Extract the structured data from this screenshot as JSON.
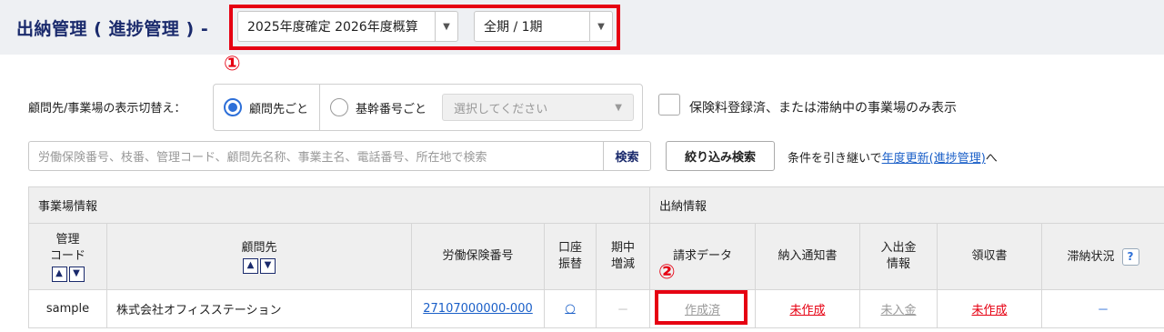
{
  "header": {
    "title": "出納管理 ( 進捗管理 ) -",
    "year_select": "2025年度確定 2026年度概算",
    "period_select": "全期 / 1期"
  },
  "annotations": {
    "one": "①",
    "two": "②"
  },
  "filters": {
    "toggle_label": "顧問先/事業場の表示切替え：",
    "radio_client": "顧問先ごと",
    "radio_base": "基幹番号ごと",
    "base_select_placeholder": "選択してください",
    "checkbox_label": "保険料登録済、または滞納中の事業場のみ表示"
  },
  "search": {
    "placeholder": "労働保険番号、枝番、管理コード、顧問先名称、事業主名、電話番号、所在地で検索",
    "search_button": "検索",
    "filter_button": "絞り込み検索",
    "carry_text": "条件を引き継いで",
    "carry_link": "年度更新(進捗管理)",
    "carry_suffix": "へ"
  },
  "table": {
    "group_site": "事業場情報",
    "group_payment": "出納情報",
    "col_code_line1": "管理",
    "col_code_line2": "コード",
    "col_client": "顧問先",
    "col_insurance_no": "労働保険番号",
    "col_account_line1": "口座",
    "col_account_line2": "振替",
    "col_change_line1": "期中",
    "col_change_line2": "増減",
    "col_billing": "請求データ",
    "col_notice": "納入通知書",
    "col_inout_line1": "入出金",
    "col_inout_line2": "情報",
    "col_receipt": "領収書",
    "col_arrears": "滞納状況",
    "rows": [
      {
        "code": "sample",
        "client": "株式会社オフィスステーション",
        "insurance_no": "27107000000-000",
        "account": "○",
        "change": "－",
        "billing": "作成済",
        "notice": "未作成",
        "inout": "未入金",
        "receipt": "未作成",
        "arrears": "－"
      }
    ]
  },
  "colors": {
    "accent_red": "#e60012",
    "title_navy": "#1a2a6c",
    "link_blue": "#1a5fc8"
  }
}
